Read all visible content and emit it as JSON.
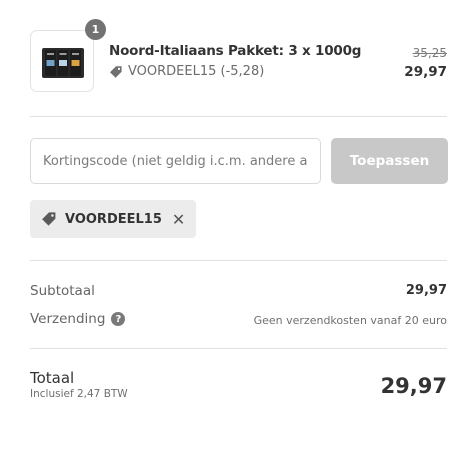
{
  "product": {
    "quantity_badge": "1",
    "name": "Noord-Italiaans Pakket: 3 x 1000g",
    "discount_label": "VOORDEEL15 (-5,28)",
    "price_original": "35,25",
    "price_current": "29,97",
    "image_icon": "coffee-bags-image"
  },
  "discount": {
    "placeholder": "Kortingscode (niet geldig i.c.m. andere aanbiedingen)",
    "value": "",
    "apply_label": "Toepassen",
    "applied_code": "VOORDEEL15",
    "remove_icon": "close-icon"
  },
  "summary": {
    "subtotal_label": "Subtotaal",
    "subtotal_value": "29,97",
    "shipping_label": "Verzending",
    "shipping_value": "Geen verzendkosten vanaf 20 euro",
    "total_label": "Totaal",
    "tax_note": "Inclusief 2,47 BTW",
    "total_value": "29,97"
  },
  "colors": {
    "button_disabled": "#c8c8c8",
    "tag_background": "#ececec",
    "badge": "#727272"
  }
}
